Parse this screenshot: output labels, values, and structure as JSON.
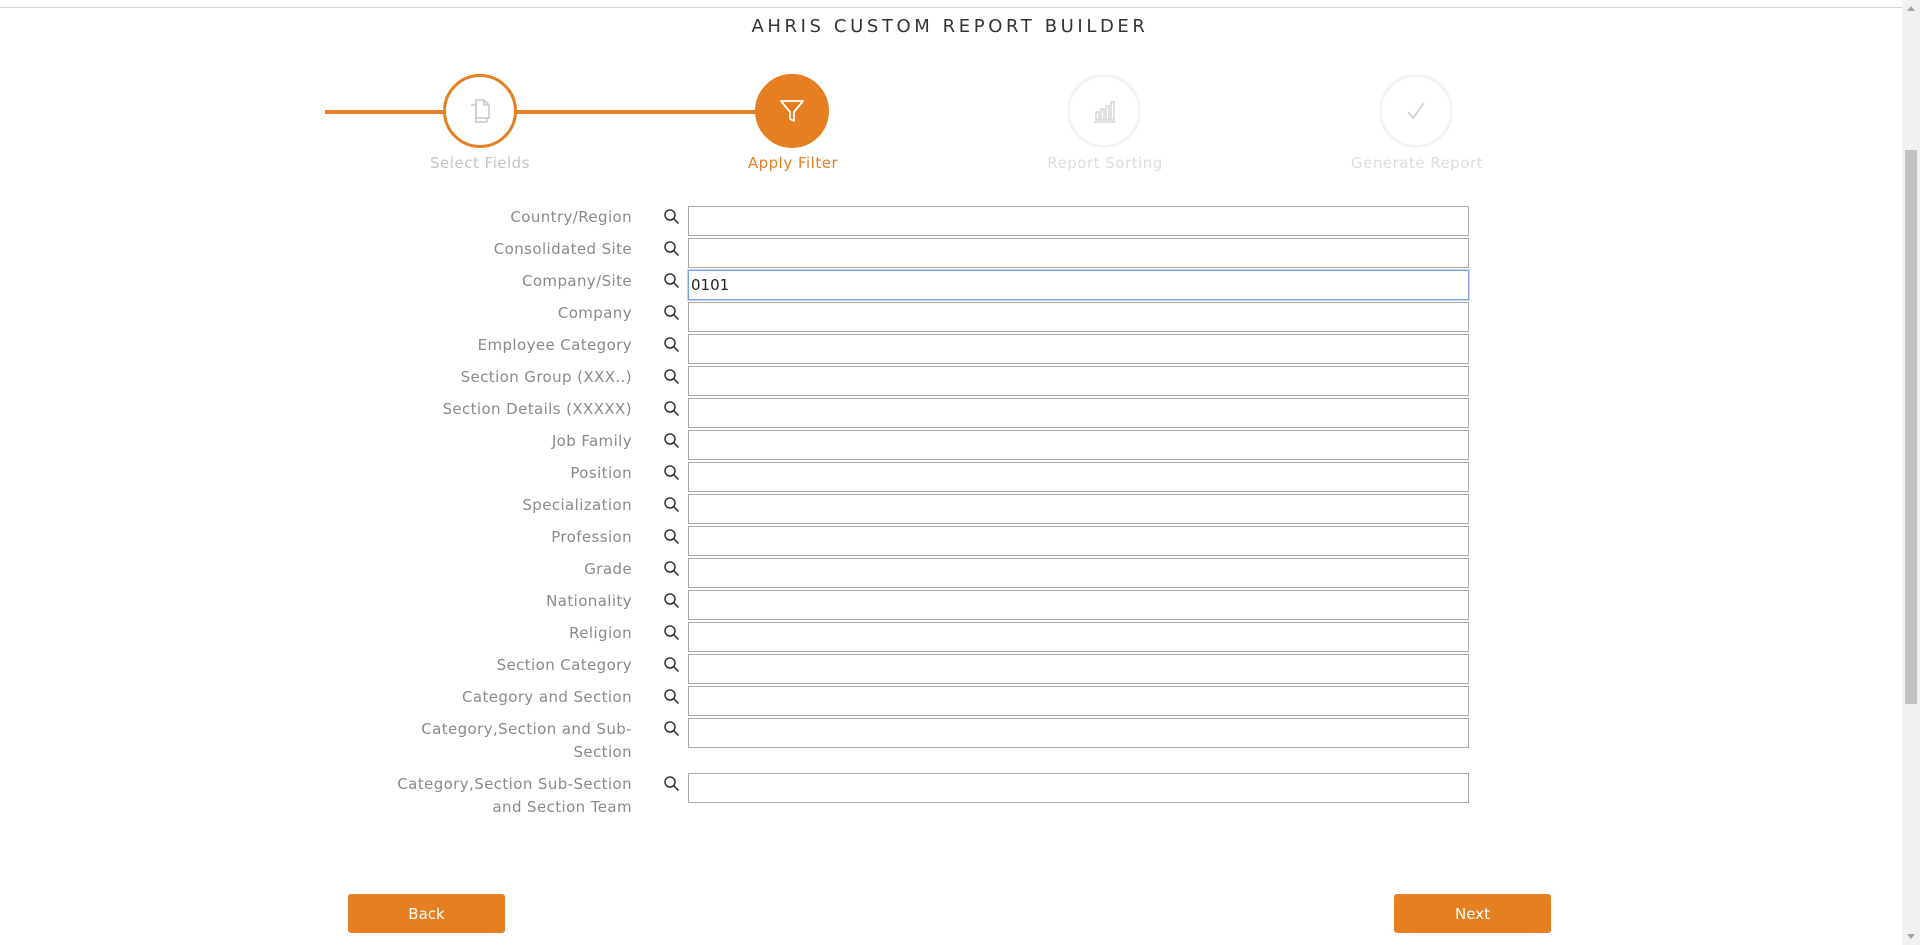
{
  "page": {
    "title": "AHRIS CUSTOM REPORT BUILDER"
  },
  "colors": {
    "accent": "#e67e22",
    "muted": "#8a8a8a"
  },
  "stepper": [
    {
      "label": "Select Fields",
      "icon": "documents-icon",
      "state": "done"
    },
    {
      "label": "Apply Filter",
      "icon": "filter-icon",
      "state": "active"
    },
    {
      "label": "Report Sorting",
      "icon": "bar-chart-icon",
      "state": "todo"
    },
    {
      "label": "Generate Report",
      "icon": "checkmark-icon",
      "state": "todo"
    }
  ],
  "filters": [
    {
      "label": "Country/Region",
      "value": ""
    },
    {
      "label": "Consolidated Site",
      "value": ""
    },
    {
      "label": "Company/Site",
      "value": "0101"
    },
    {
      "label": "Company",
      "value": ""
    },
    {
      "label": "Employee Category",
      "value": ""
    },
    {
      "label": "Section Group (XXX..)",
      "value": ""
    },
    {
      "label": "Section Details (XXXXX)",
      "value": ""
    },
    {
      "label": "Job Family",
      "value": ""
    },
    {
      "label": "Position",
      "value": ""
    },
    {
      "label": "Specialization",
      "value": ""
    },
    {
      "label": "Profession",
      "value": ""
    },
    {
      "label": "Grade",
      "value": ""
    },
    {
      "label": "Nationality",
      "value": ""
    },
    {
      "label": "Religion",
      "value": ""
    },
    {
      "label": "Section Category",
      "value": ""
    },
    {
      "label": "Category and Section",
      "value": ""
    },
    {
      "label": "Category,Section and Sub-Section",
      "value": ""
    },
    {
      "label": "Category,Section Sub-Section and Section Team",
      "value": ""
    }
  ],
  "buttons": {
    "back": "Back",
    "next": "Next"
  }
}
